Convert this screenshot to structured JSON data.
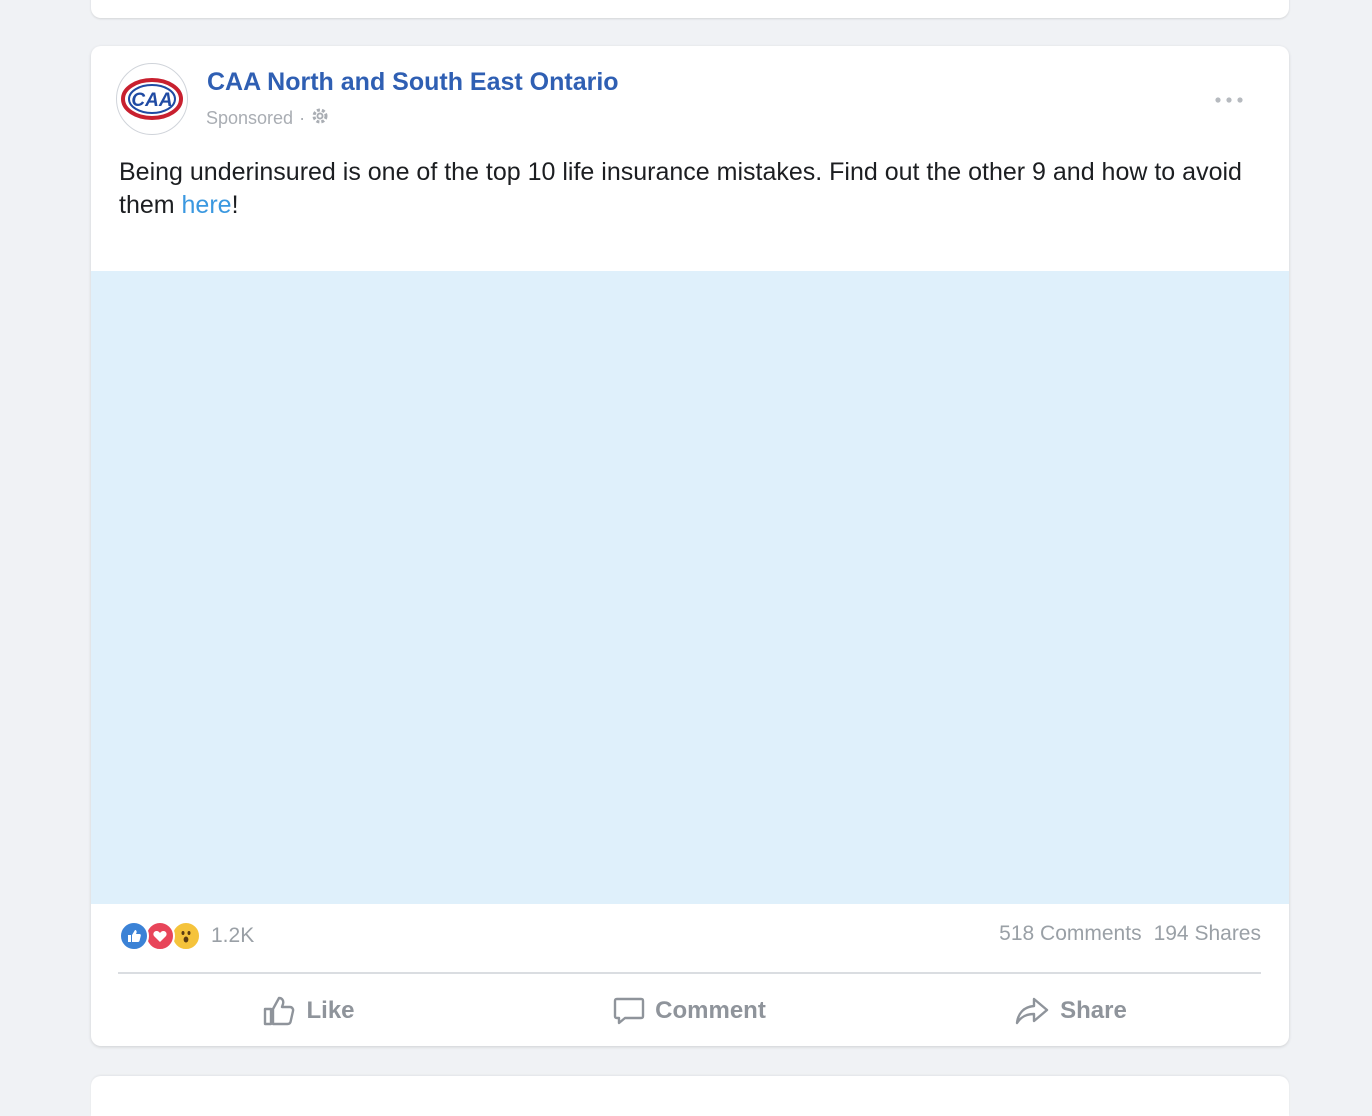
{
  "post": {
    "page_name": "CAA North and South East Ontario",
    "sponsored_label": "Sponsored",
    "meta_separator": "·",
    "text_before_link": "Being underinsured is one of the top 10 life insurance mistakes. Find out the other 9 and how to avoid them ",
    "link_text": "here",
    "text_after_link": "!",
    "avatar_logo_text": "CAA",
    "media_color": "#dff0fb",
    "more_icon": "more-options-icon"
  },
  "engagement": {
    "reactions": [
      "like",
      "love",
      "wow"
    ],
    "reaction_count": "1.2K",
    "comments": "518 Comments",
    "shares": "194 Shares"
  },
  "actions": {
    "like": "Like",
    "comment": "Comment",
    "share": "Share"
  },
  "colors": {
    "page_name": "#2f5fb3",
    "link": "#3a98e0",
    "background": "#f0f2f5",
    "like_reaction": "#3b82d6",
    "love_reaction": "#e8455a",
    "wow_reaction": "#f5c33b"
  }
}
